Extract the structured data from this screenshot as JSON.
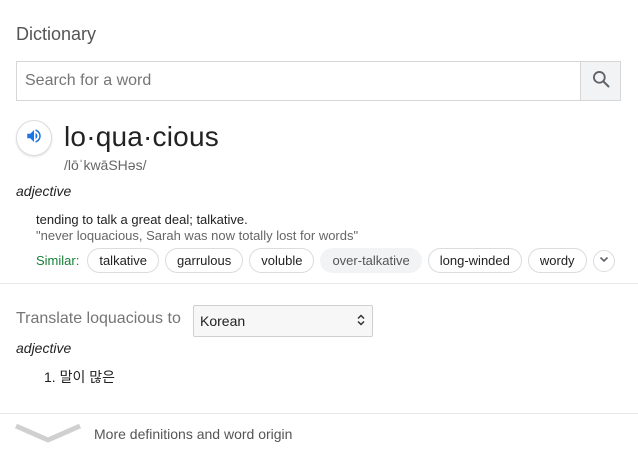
{
  "dictionary": {
    "title": "Dictionary",
    "search": {
      "placeholder": "Search for a word",
      "value": ""
    },
    "entry": {
      "word": "lo·qua·cious",
      "phonetic": "/lōˈkwāSHəs/",
      "part_of_speech": "adjective",
      "definition": "tending to talk a great deal; talkative.",
      "example": "\"never loquacious, Sarah was now totally lost for words\"",
      "similar_label": "Similar:",
      "similar": [
        "talkative",
        "garrulous",
        "voluble",
        "over-talkative",
        "long-winded",
        "wordy"
      ]
    },
    "translate": {
      "label": "Translate loquacious to",
      "language": "Korean",
      "part_of_speech": "adjective",
      "items": [
        "1. 말이 많은"
      ]
    },
    "more": {
      "label": "More definitions and word origin"
    }
  },
  "icons": {
    "search": "search-icon",
    "audio": "speaker-icon",
    "expand": "chevron-down-icon",
    "select": "select-arrows-icon",
    "more": "chevron-down-icon"
  },
  "colors": {
    "similar_label": "#188038",
    "audio_icon": "#1a73e8"
  }
}
